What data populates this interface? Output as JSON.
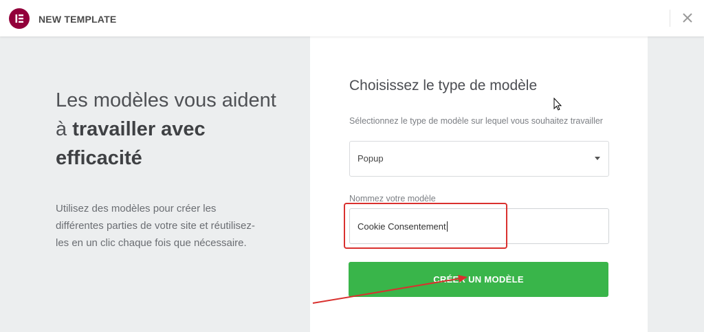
{
  "header": {
    "title": "NEW TEMPLATE",
    "logo_icon": "elementor-logo-icon",
    "close_icon": "close-icon",
    "logo_color": "#92003b"
  },
  "intro": {
    "heading_light": "Les modèles vous aident à ",
    "heading_bold": "travailler avec efficacité",
    "description": "Utilisez des modèles pour créer les différentes parties de votre site et réutilisez-les en un clic chaque fois que nécessaire."
  },
  "form": {
    "title": "Choisissez le type de modèle",
    "type_label": "Sélectionnez le type de modèle sur lequel vous souhaitez travailler",
    "type_value": "Popup",
    "name_label": "Nommez votre modèle",
    "name_value": "Cookie Consentement",
    "submit_label": "CRÉER UN MODÈLE",
    "accent_color": "#39b54a"
  },
  "annotation": {
    "color": "#d9302e"
  }
}
